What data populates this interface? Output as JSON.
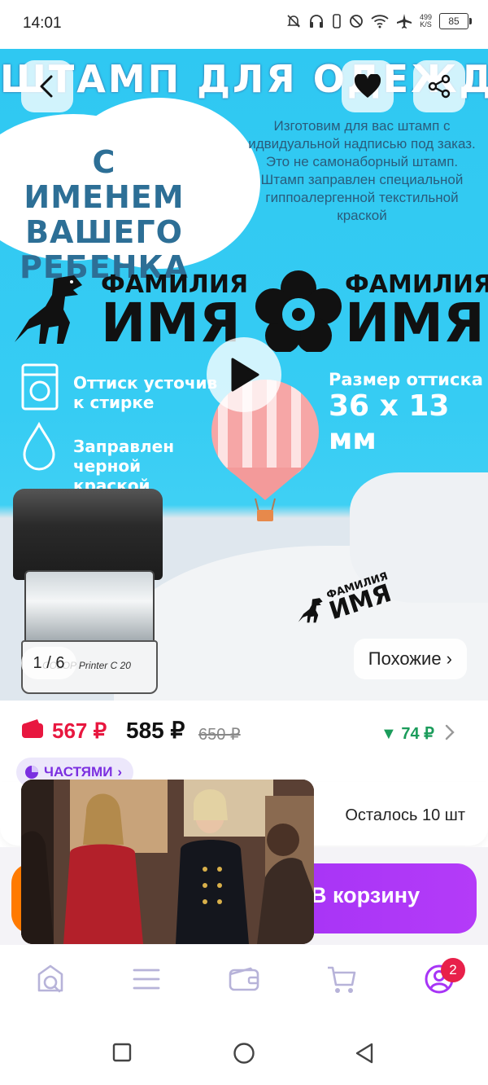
{
  "status_bar": {
    "time": "14:01",
    "speed_value": "499",
    "speed_unit": "K/S",
    "battery": "85"
  },
  "hero": {
    "banner_title": "ШТАМП ДЛЯ ОДЕЖДЫ",
    "headline": "С ИМЕНЕМ ВАШЕГО РЕБЕНКА",
    "description": "Изготовим для вас штамп с идвидуальной надписью под заказ. Это не самонаборный штамп. Штамп заправлен специальной гиппоалергенной текстильной краской",
    "sample_surname": "ФАМИЛИЯ",
    "sample_name": "ИМЯ",
    "feature_wash": "Оттиск усточив к стирке",
    "feature_ink": "Заправлен черной краской",
    "size_label": "Размер оттиска",
    "size_value": "36 x 13 мм",
    "stamp_brand": "COLOP Printer C 20",
    "counter": "1 / 6",
    "similar_button": "Похожие ›"
  },
  "price": {
    "card_price": "567 ₽",
    "regular_price": "585 ₽",
    "old_price": "650 ₽",
    "discount": "▼ 74 ₽",
    "installments_label": "ЧАСТЯМИ"
  },
  "stock": {
    "text": "Осталось 10 шт"
  },
  "cart_button": {
    "label": "В корзину"
  },
  "tab_bar": {
    "cart_badge": "2"
  },
  "colors": {
    "accent": "#a734f6",
    "price_red": "#e8173f",
    "discount_green": "#1b9c5b",
    "hero_blue": "#36ccf3"
  }
}
